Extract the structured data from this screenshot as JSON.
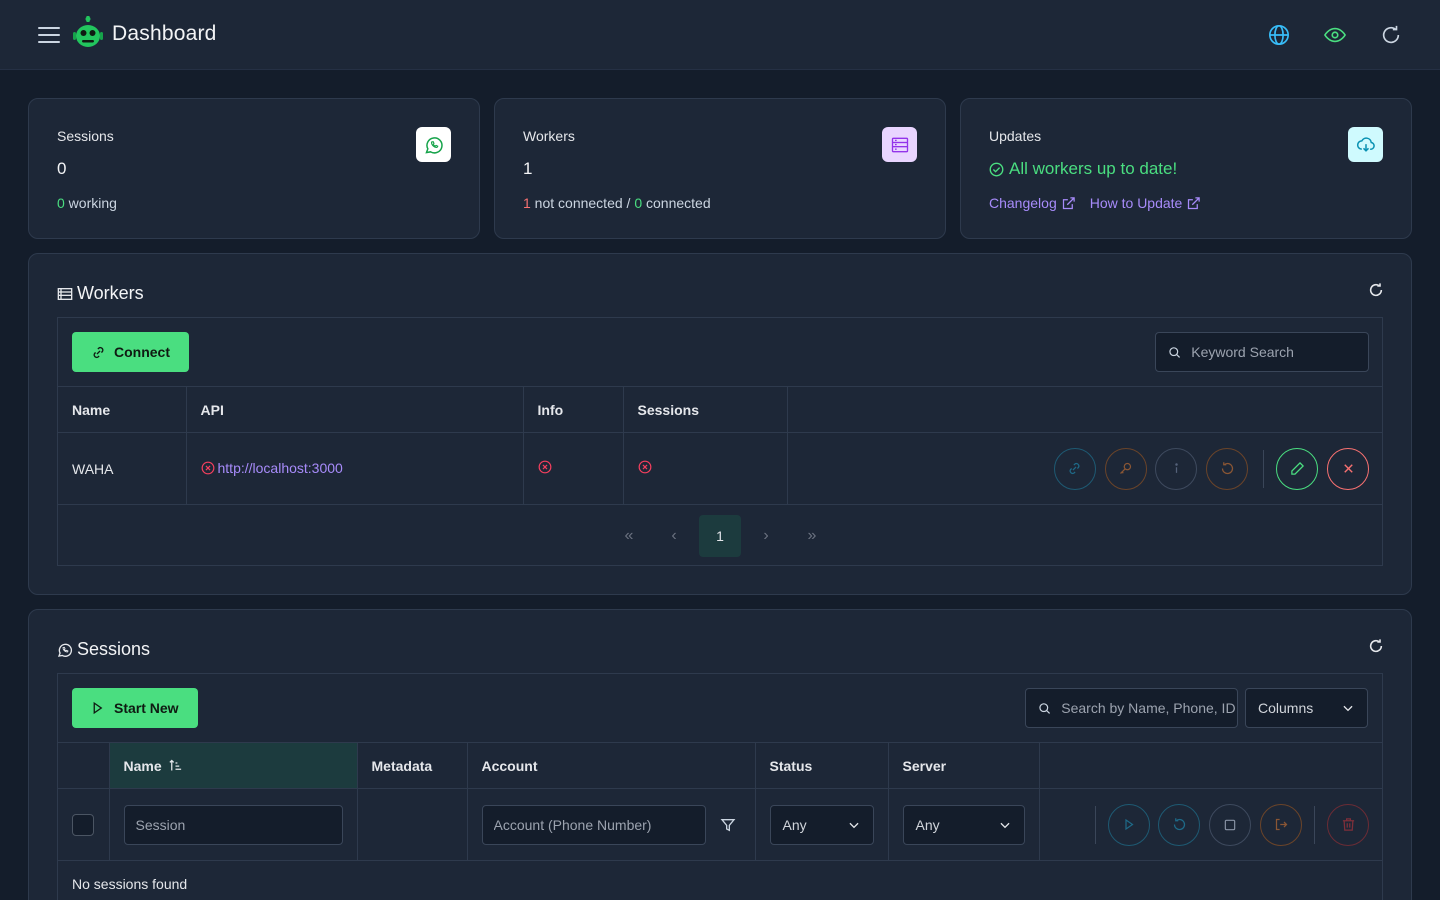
{
  "app": {
    "title": "Dashboard"
  },
  "stats": {
    "sessions": {
      "title": "Sessions",
      "value": "0",
      "working_count": "0",
      "working_label": " working"
    },
    "workers": {
      "title": "Workers",
      "value": "1",
      "not_connected_count": "1",
      "not_connected_label": " not connected / ",
      "connected_count": "0",
      "connected_label": " connected"
    },
    "updates": {
      "title": "Updates",
      "status": "All workers up to date!",
      "changelog": "Changelog",
      "how_to_update": "How to Update"
    }
  },
  "workers_section": {
    "title": "Workers",
    "connect_label": "Connect",
    "search_placeholder": "Keyword Search",
    "columns": [
      "Name",
      "API",
      "Info",
      "Sessions"
    ],
    "rows": [
      {
        "name": "WAHA",
        "api": "http://localhost:3000"
      }
    ],
    "pagination": {
      "current": "1",
      "first": "«",
      "prev": "‹",
      "next": "›",
      "last": "»"
    }
  },
  "sessions_section": {
    "title": "Sessions",
    "start_label": "Start New",
    "search_placeholder": "Search by Name, Phone, ID",
    "columns_label": "Columns",
    "columns": [
      "Name",
      "Metadata",
      "Account",
      "Status",
      "Server"
    ],
    "filters": {
      "session_placeholder": "Session",
      "account_placeholder": "Account (Phone Number)",
      "status": "Any",
      "server": "Any"
    },
    "empty": "No sessions found"
  },
  "colors": {
    "accent": "#4ade80",
    "danger": "#f87171",
    "link": "#a78bfa",
    "background": "#141d2b",
    "card": "#1d2737"
  }
}
